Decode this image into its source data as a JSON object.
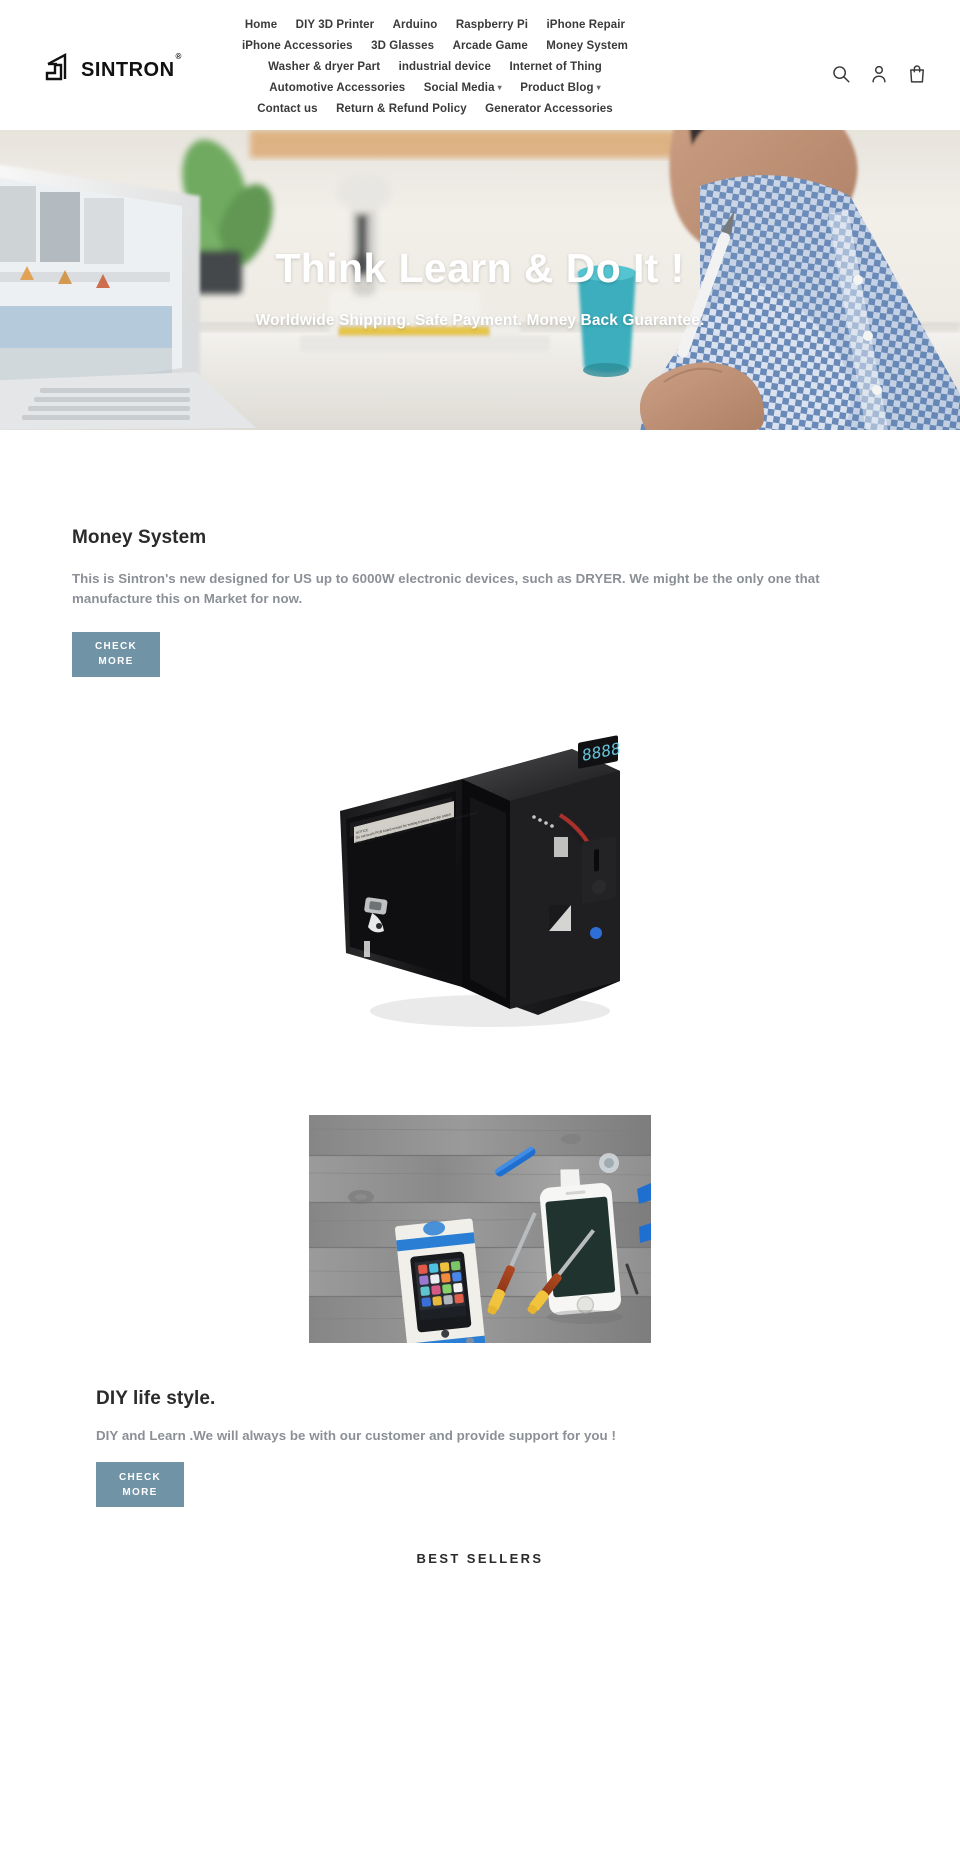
{
  "header": {
    "logo": {
      "word": "SINTRON",
      "registered_mark": "®"
    },
    "nav_rows": [
      [
        {
          "label": "Home",
          "has_caret": false
        },
        {
          "label": "DIY 3D Printer",
          "has_caret": false
        },
        {
          "label": "Arduino",
          "has_caret": false
        },
        {
          "label": "Raspberry Pi",
          "has_caret": false
        },
        {
          "label": "iPhone Repair",
          "has_caret": false
        }
      ],
      [
        {
          "label": "iPhone Accessories",
          "has_caret": false
        },
        {
          "label": "3D Glasses",
          "has_caret": false
        },
        {
          "label": "Arcade Game",
          "has_caret": false
        },
        {
          "label": "Money System",
          "has_caret": false
        }
      ],
      [
        {
          "label": "Washer & dryer Part",
          "has_caret": false
        },
        {
          "label": "industrial device",
          "has_caret": false
        },
        {
          "label": "Internet of Thing",
          "has_caret": false
        }
      ],
      [
        {
          "label": "Automotive Accessories",
          "has_caret": false
        },
        {
          "label": "Social Media",
          "has_caret": true
        },
        {
          "label": "Product Blog",
          "has_caret": true
        }
      ],
      [
        {
          "label": "Contact us",
          "has_caret": false
        },
        {
          "label": "Return & Refund Policy",
          "has_caret": false
        },
        {
          "label": "Generator Accessories",
          "has_caret": false
        }
      ]
    ],
    "icons": [
      {
        "name": "search-icon"
      },
      {
        "name": "account-icon"
      },
      {
        "name": "cart-icon"
      }
    ]
  },
  "hero": {
    "title": "Think Learn & Do It !",
    "subtitle": "Worldwide Shipping. Safe Payment. Money Back Guarantee."
  },
  "features": [
    {
      "title": "Money System",
      "body": "This is Sintron's new designed for US up to 6000W electronic devices, such as DRYER. We might be the only one that manufacture this on Market for now.",
      "button_line1": "CHECK",
      "button_line2": "MORE",
      "image_alt": "coin-operated-money-box-photo"
    },
    {
      "title": "DIY life style.",
      "body": "DIY and Learn .We will always be with our customer and provide support for you !",
      "button_line1": "CHECK",
      "button_line2": "MORE",
      "image_alt": "iphone-repair-tools-photo"
    }
  ],
  "best_sellers": {
    "title": "BEST SELLERS"
  },
  "colors": {
    "button": "#7193a6",
    "text_dark": "#2b2b2b",
    "text_muted": "#8b8f96",
    "page_bg": "#ffffff"
  }
}
